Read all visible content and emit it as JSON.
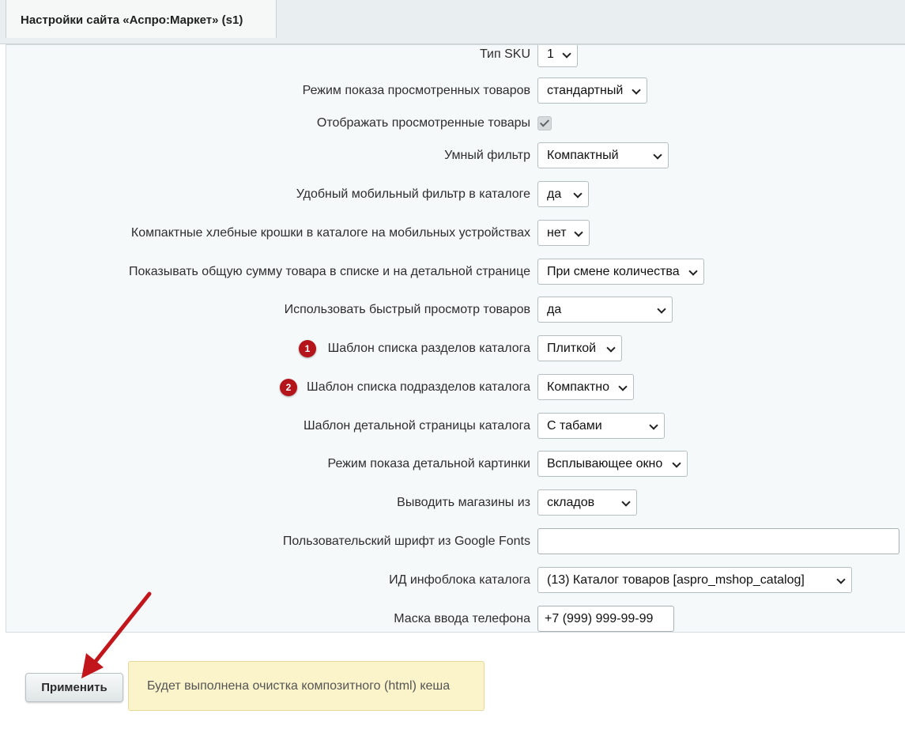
{
  "tab": {
    "title": "Настройки сайта «Аспро:Маркет» (s1)"
  },
  "settings": [
    {
      "label": "Тип SKU",
      "type": "select",
      "value": "1"
    },
    {
      "label": "Режим показа просмотренных товаров",
      "type": "select",
      "value": "стандартный"
    },
    {
      "label": "Отображать просмотренные товары",
      "type": "checkbox",
      "checked": true
    },
    {
      "label": "Умный фильтр",
      "type": "select",
      "value": "Компактный"
    },
    {
      "label": "Удобный мобильный фильтр в каталоге",
      "type": "select",
      "value": "да"
    },
    {
      "label": "Компактные хлебные крошки в каталоге на мобильных устройствах",
      "type": "select",
      "value": "нет"
    },
    {
      "label": "Показывать общую сумму товара в списке и на детальной странице",
      "type": "select",
      "value": "При смене количества"
    },
    {
      "label": "Использовать быстрый просмотр товаров",
      "type": "select",
      "value": "да"
    },
    {
      "label": "Шаблон списка разделов каталога",
      "type": "select",
      "value": "Плиткой",
      "badge": "1"
    },
    {
      "label": "Шаблон списка подразделов каталога",
      "type": "select",
      "value": "Компактно",
      "badge": "2"
    },
    {
      "label": "Шаблон детальной страницы каталога",
      "type": "select",
      "value": "С табами"
    },
    {
      "label": "Режим показа детальной картинки",
      "type": "select",
      "value": "Всплывающее окно"
    },
    {
      "label": "Выводить магазины из",
      "type": "select",
      "value": "складов"
    },
    {
      "label": "Пользовательский шрифт из Google Fonts",
      "type": "text",
      "value": ""
    },
    {
      "label": "ИД инфоблока каталога",
      "type": "select",
      "value": "(13) Каталог товаров [aspro_mshop_catalog]"
    },
    {
      "label": "Маска ввода телефона",
      "type": "text",
      "value": "+7 (999) 999-99-99"
    }
  ],
  "footer": {
    "apply_label": "Применить",
    "note": "Будет выполнена очистка композитного (html) кеша"
  },
  "colors": {
    "badge": "#b3151a",
    "arrow": "#c0161c",
    "note_bg": "#fbf3c9"
  }
}
